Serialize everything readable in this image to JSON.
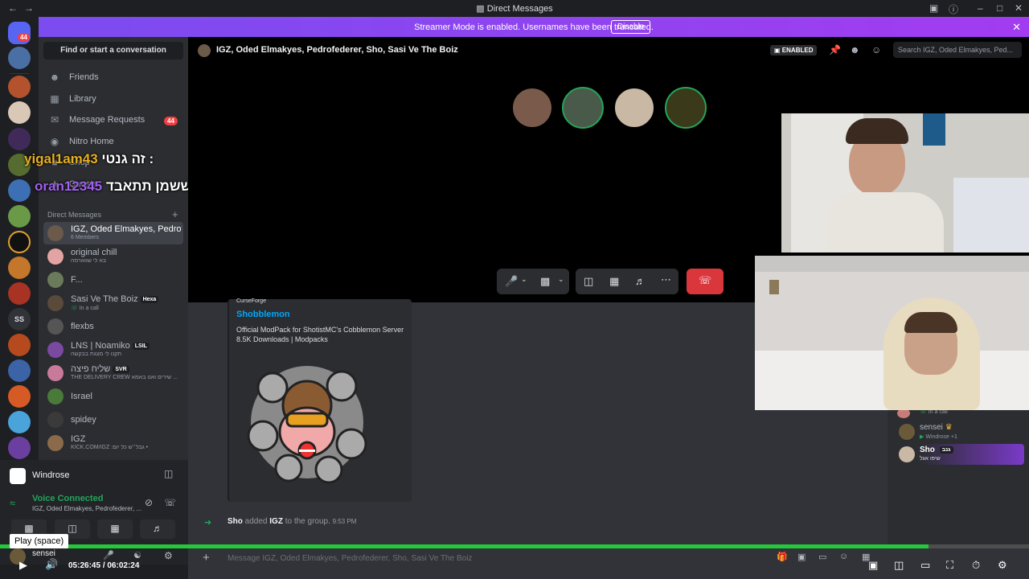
{
  "window": {
    "title": "Direct Messages"
  },
  "banner": {
    "message": "Streamer Mode is enabled. Usernames have been truncated.",
    "disable_label": "Disable"
  },
  "rail": {
    "home_badge": "44"
  },
  "sidebar": {
    "find_label": "Find or start a conversation",
    "nav": [
      {
        "label": "Friends",
        "icon": "friends-icon"
      },
      {
        "label": "Library",
        "icon": "library-icon"
      },
      {
        "label": "Message Requests",
        "icon": "mail-icon",
        "badge": "44"
      },
      {
        "label": "Nitro Home",
        "icon": "nitro-icon"
      },
      {
        "label": "Shop",
        "icon": "shop-icon"
      },
      {
        "label": "Quests",
        "icon": "quests-icon"
      }
    ],
    "dm_header": "Direct Messages",
    "dms": [
      {
        "name": "IGZ, Oded Elmakyes, Pedrof...",
        "sub": "6 Members"
      },
      {
        "name": "original chill",
        "sub": "בא לי שווארמה"
      },
      {
        "name": "F...",
        "sub": ""
      },
      {
        "name": "Sasi Ve The Boiz",
        "tag": "Hexa",
        "sub": "In a call"
      },
      {
        "name": "flexbs",
        "sub": ""
      },
      {
        "name": "LNS | Noamiko",
        "tag": "LSIL",
        "sub": "תקנו לי מצגת בבקשה"
      },
      {
        "name": "שליח פיצה",
        "tag": "SVR",
        "sub": "THE DELIVERY CREW שירים ואנו באמא ..."
      },
      {
        "name": "Israel",
        "sub": ""
      },
      {
        "name": "spidey",
        "sub": ""
      },
      {
        "name": "IGZ",
        "sub": "KICK.COM/IGZ :גבל״ש כל יום •"
      }
    ]
  },
  "overlay_chat": [
    {
      "user": "yigal1am43",
      "text": "זה גנטי :"
    },
    {
      "user": "oran12345",
      "text": "מי ששמן תתאבד :"
    }
  ],
  "user_panel": {
    "activity": "Windrose",
    "voice_status": "Voice Connected",
    "voice_channel": "IGZ, Oded Elmakyes, Pedrofederer, ...",
    "username": "sensei",
    "user_sub": "Windrose"
  },
  "channel": {
    "title": "IGZ, Oded Elmakyes, Pedrofederer, Sho, Sasi Ve The Boiz",
    "enabled_badge": "ENABLED",
    "search_placeholder": "Search IGZ, Oded Elmakyes, Ped..."
  },
  "embed": {
    "provider": "CurseForge",
    "title": "Shobblemon",
    "desc1": "Official ModPack for ShotistMC's Cobblemon Server",
    "desc2": "8.5K Downloads | Modpacks"
  },
  "system_message": {
    "user": "Sho",
    "action": "added",
    "target": "IGZ",
    "rest": "to the group.",
    "time": "9:53 PM"
  },
  "members": [
    {
      "name": "",
      "sub": "In a call"
    },
    {
      "name": "sensei",
      "sub": "Windrose +1"
    },
    {
      "name": "Sho",
      "tag": "גנב",
      "sub": "שיפו אגל"
    }
  ],
  "input": {
    "placeholder": "Message IGZ, Oded Elmakyes, Pedrofederer, Sho, Sasi Ve The Boiz"
  },
  "player": {
    "tooltip": "Play (space)",
    "current": "05:26:45",
    "separator": "/",
    "total": "06:02:24",
    "progress": 0.902
  },
  "colors": {
    "accent": "#5865f2",
    "green": "#23a55a",
    "red": "#da373c",
    "banner": "#9b3ff0"
  }
}
